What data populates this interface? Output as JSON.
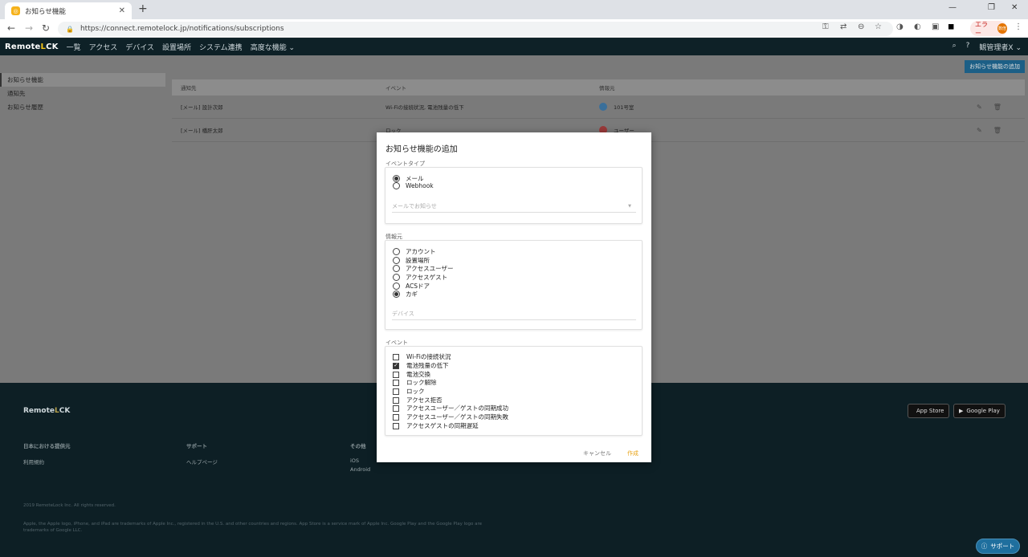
{
  "browser": {
    "tab_title": "お知らせ機能",
    "url": "https://connect.remotelock.jp/notifications/subscriptions",
    "error_label": "エラー",
    "profile_initials": "数倍"
  },
  "topnav": {
    "brand_prefix": "Remote",
    "brand_o": "L",
    "brand_suffix": "CK",
    "items": [
      "一覧",
      "アクセス",
      "デバイス",
      "設置場所",
      "システム連携",
      "高度な機能 ⌄"
    ],
    "user": "観管理者X ⌄"
  },
  "page": {
    "add_button": "お知らせ機能の追加",
    "sidebar": [
      "お知らせ機能",
      "通知先",
      "お知らせ履歴"
    ],
    "table": {
      "headers": [
        "通知先",
        "イベント",
        "情報元"
      ],
      "rows": [
        {
          "to": "[メール] 設計次郎",
          "event": "Wi-Fiの接続状況, 電池残量の低下",
          "source": "101号室"
        },
        {
          "to": "[メール] 橋肝太郎",
          "event": "ロック",
          "source": "ユーザー"
        }
      ]
    }
  },
  "footer": {
    "brand_prefix": "Remote",
    "brand_o": "L",
    "brand_suffix": "CK",
    "app_store": "App Store",
    "google_play": "Google Play",
    "cols": [
      {
        "heading": "日本における提供元",
        "links": [
          "利用規約"
        ]
      },
      {
        "heading": "サポート",
        "links": [
          "ヘルプページ"
        ]
      },
      {
        "heading": "その他",
        "links": [
          "iOS",
          "Android"
        ]
      }
    ],
    "copyright": "2019 RemoteLock Inc. All rights reserved.",
    "legal": "Apple, the Apple logo, iPhone, and iPad are trademarks of Apple Inc., registered in the U.S. and other countries and regions. App Store is a service mark of Apple Inc. Google Play and the Google Play logo are trademarks of Google LLC.",
    "support_button": "サポート"
  },
  "modal": {
    "title": "お知らせ機能の追加",
    "event_type_label": "イベントタイプ",
    "event_types": [
      {
        "label": "メール",
        "selected": true
      },
      {
        "label": "Webhook",
        "selected": false
      }
    ],
    "email_placeholder": "メールでお知らせ",
    "source_label": "情報元",
    "sources": [
      {
        "label": "アカウント",
        "selected": false
      },
      {
        "label": "設置場所",
        "selected": false
      },
      {
        "label": "アクセスユーザー",
        "selected": false
      },
      {
        "label": "アクセスゲスト",
        "selected": false
      },
      {
        "label": "ACSドア",
        "selected": false
      },
      {
        "label": "カギ",
        "selected": true
      }
    ],
    "device_placeholder": "デバイス",
    "events_label": "イベント",
    "events": [
      {
        "label": "Wi-Fiの接続状況",
        "checked": false
      },
      {
        "label": "電池残量の低下",
        "checked": true
      },
      {
        "label": "電池交換",
        "checked": false
      },
      {
        "label": "ロック解除",
        "checked": false
      },
      {
        "label": "ロック",
        "checked": false
      },
      {
        "label": "アクセス拒否",
        "checked": false
      },
      {
        "label": "アクセスユーザー／ゲストの同期成功",
        "checked": false
      },
      {
        "label": "アクセスユーザー／ゲストの同期失敗",
        "checked": false
      },
      {
        "label": "アクセスゲストの同期遅延",
        "checked": false
      }
    ],
    "cancel": "キャンセル",
    "create": "作成"
  }
}
